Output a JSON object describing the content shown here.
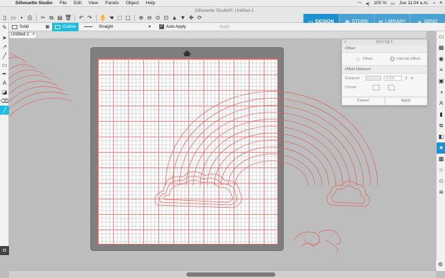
{
  "menubar": {
    "app_name": "Silhouette Studio",
    "items": [
      "File",
      "Edit",
      "View",
      "Panels",
      "Object",
      "Help"
    ],
    "battery": "100 %",
    "clock": "Jue 11:04 a.m."
  },
  "window": {
    "title": "Silhouette Studio®: Untitled-1"
  },
  "navtabs": [
    {
      "label": "DESIGN",
      "icon": "design-icon"
    },
    {
      "label": "STORE",
      "icon": "store-icon"
    },
    {
      "label": "LIBRARY",
      "icon": "library-icon"
    },
    {
      "label": "SEND",
      "icon": "send-icon"
    }
  ],
  "options": {
    "fill_label": "Solid",
    "outline_label": "Outline",
    "line_label": "Straight",
    "auto_apply_label": "Auto Apply",
    "apply_label": "Apply"
  },
  "doc_tab": {
    "label": "Untitled-1",
    "close": "×"
  },
  "offset_panel": {
    "title": "OFFSET",
    "section_offset": "Offset",
    "choice_offset": "Offset",
    "choice_internal": "Internal Offset",
    "section_distance": "Offset Distance",
    "distance_label": "Distance",
    "distance_value": "0.000",
    "distance_unit": "in",
    "corner_label": "Corner",
    "cancel_label": "Cancel",
    "apply_label": "Apply"
  },
  "colors": {
    "accent": "#1bbde0",
    "nav_blue": "#1e8fcf",
    "cut_line": "#e06060"
  }
}
